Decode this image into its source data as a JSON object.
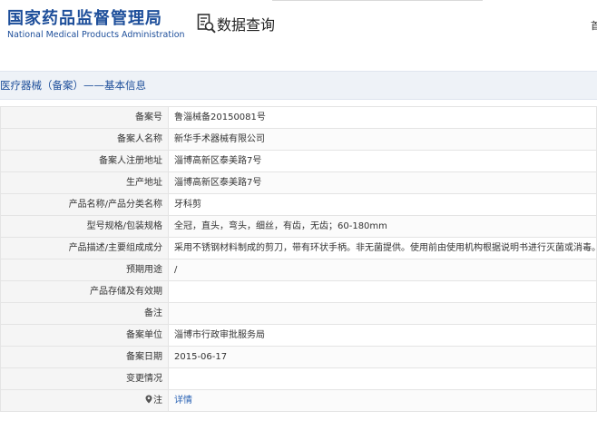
{
  "header": {
    "logo_cn": "国家药品监督管理局",
    "logo_en": "National Medical Products Administration",
    "query_label": "数据查询",
    "right_text": "首"
  },
  "section": {
    "title": "医疗器械（备案）——基本信息"
  },
  "rows": [
    {
      "label": "备案号",
      "value": "鲁淄械备20150081号"
    },
    {
      "label": "备案人名称",
      "value": "新华手术器械有限公司"
    },
    {
      "label": "备案人注册地址",
      "value": "淄博高新区泰美路7号"
    },
    {
      "label": "生产地址",
      "value": "淄博高新区泰美路7号"
    },
    {
      "label": "产品名称/产品分类名称",
      "value": "牙科剪"
    },
    {
      "label": "型号规格/包装规格",
      "value": "全冠，直头，弯头，细丝，有齿，无齿；60-180mm"
    },
    {
      "label": "产品描述/主要组成成分",
      "value": "采用不锈钢材料制成的剪刀，带有环状手柄。非无菌提供。使用前由使用机构根据说明书进行灭菌或消毒。"
    },
    {
      "label": "预期用途",
      "value": "/"
    },
    {
      "label": "产品存储及有效期",
      "value": ""
    },
    {
      "label": "备注",
      "value": ""
    },
    {
      "label": "备案单位",
      "value": "淄博市行政审批服务局"
    },
    {
      "label": "备案日期",
      "value": "2015-06-17"
    },
    {
      "label": "变更情况",
      "value": ""
    }
  ],
  "note_row": {
    "label": "注",
    "link_text": "详情"
  },
  "colors": {
    "brand_blue": "#1d4e9a",
    "link_blue": "#2a63b5",
    "label_bg": "#f5f5f5",
    "border": "#e4e4e4"
  }
}
